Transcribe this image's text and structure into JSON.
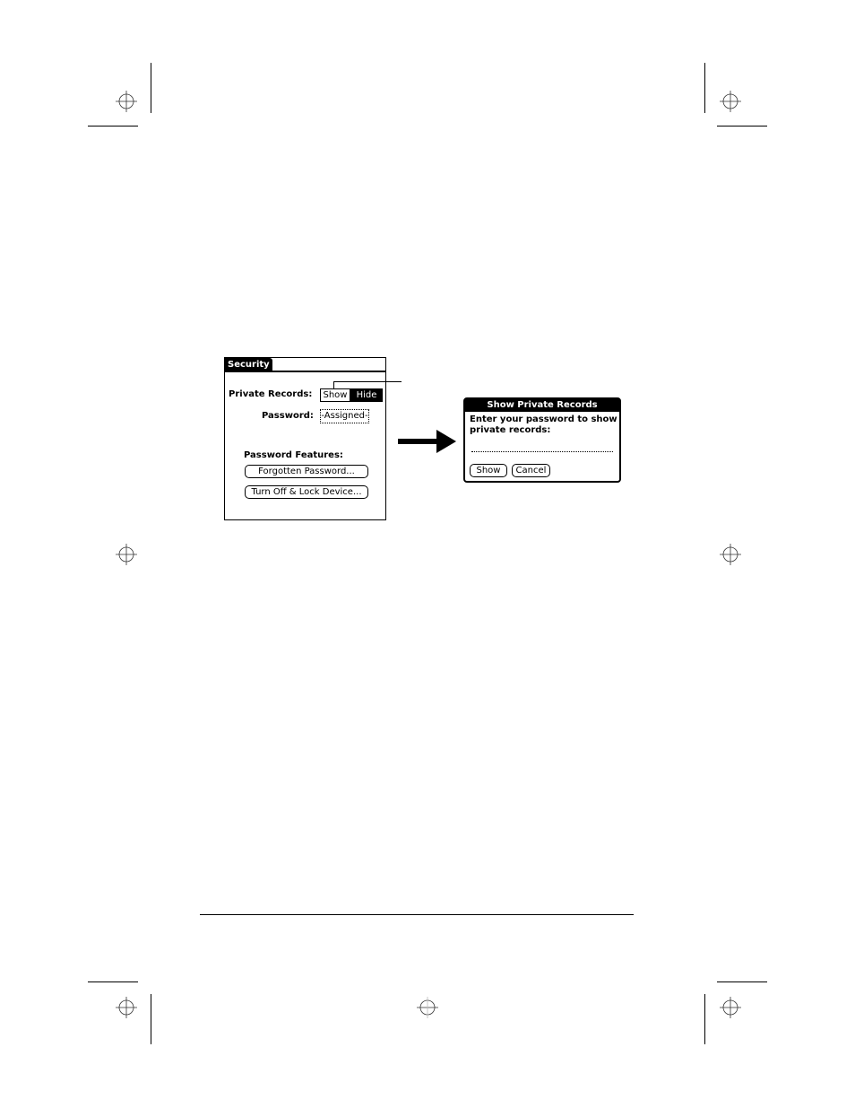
{
  "security_screen": {
    "title": "Security",
    "private_records_label": "Private Records:",
    "private_records_options": [
      "Show",
      "Hide"
    ],
    "private_records_selected": "Hide",
    "password_label": "Password:",
    "password_value": "-Assigned-",
    "features_label": "Password Features:",
    "forgotten_password_button": "Forgotten Password...",
    "lock_device_button": "Turn Off & Lock Device..."
  },
  "arrow": {
    "icon": "arrow-right-icon"
  },
  "dialog": {
    "title": "Show Private Records",
    "message": "Enter your password to show private records:",
    "password_input_value": "",
    "show_button": "Show",
    "cancel_button": "Cancel"
  },
  "page_marks": {
    "registration_icon": "crosshair-registration-icon"
  }
}
